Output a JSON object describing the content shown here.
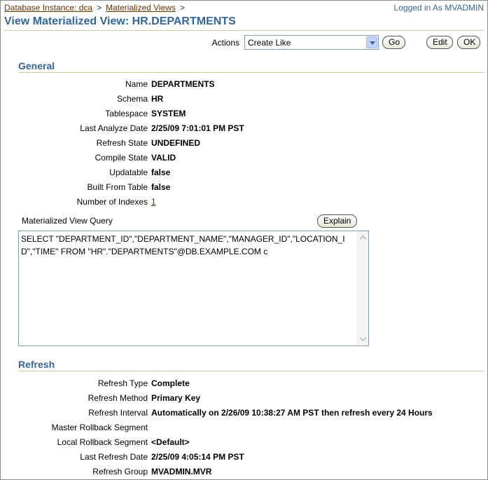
{
  "breadcrumb": {
    "items": [
      "Database Instance: dca",
      "Materialized Views"
    ],
    "separator": ">"
  },
  "login_text": "Logged in As MVADMIN",
  "page_title": "View Materialized View: HR.DEPARTMENTS",
  "actions": {
    "label": "Actions",
    "selected": "Create Like",
    "go_label": "Go",
    "edit_label": "Edit",
    "ok_label": "OK"
  },
  "general": {
    "title": "General",
    "fields": [
      {
        "label": "Name",
        "value": "DEPARTMENTS"
      },
      {
        "label": "Schema",
        "value": "HR"
      },
      {
        "label": "Tablespace",
        "value": "SYSTEM"
      },
      {
        "label": "Last Analyze Date",
        "value": "2/25/09 7:01:01 PM PST"
      },
      {
        "label": "Refresh State",
        "value": "UNDEFINED"
      },
      {
        "label": "Compile State",
        "value": "VALID"
      },
      {
        "label": "Updatable",
        "value": "false"
      },
      {
        "label": "Built From Table",
        "value": "false"
      },
      {
        "label": "Number of Indexes",
        "value": "1"
      }
    ],
    "query_label": "Materialized View Query",
    "explain_label": "Explain",
    "query_text": "SELECT \"DEPARTMENT_ID\",\"DEPARTMENT_NAME\",\"MANAGER_ID\",\"LOCATION_ID\",\"TIME\" FROM \"HR\".\"DEPARTMENTS\"@DB.EXAMPLE.COM c"
  },
  "refresh": {
    "title": "Refresh",
    "fields": [
      {
        "label": "Refresh Type",
        "value": "Complete"
      },
      {
        "label": "Refresh Method",
        "value": "Primary Key"
      },
      {
        "label": "Refresh Interval",
        "value": "Automatically on 2/26/09 10:38:27 AM PST then refresh every 24 Hours"
      },
      {
        "label": "Master Rollback Segment",
        "value": ""
      },
      {
        "label": "Local Rollback Segment",
        "value": "<Default>"
      },
      {
        "label": "Last Refresh Date",
        "value": "2/25/09 4:05:14 PM PST"
      },
      {
        "label": "Refresh Group",
        "value": "MVADMIN.MVR"
      }
    ]
  },
  "colors": {
    "title": "#336699",
    "link": "#663300",
    "rule": "#cccc99"
  },
  "icons": {
    "dropdown": "chevron-down-icon",
    "scroll_up": "chevron-up-icon",
    "scroll_down": "chevron-down-icon"
  }
}
